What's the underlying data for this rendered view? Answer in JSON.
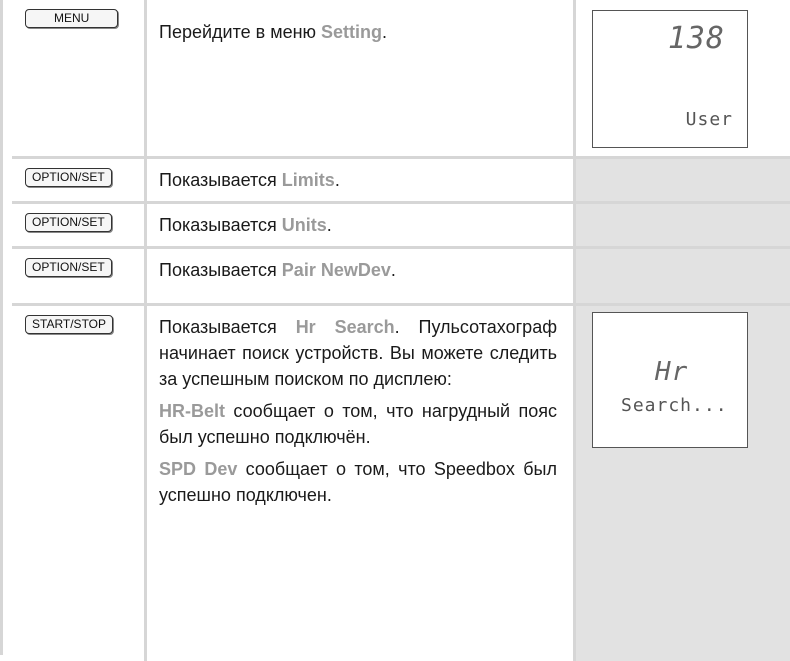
{
  "rows": [
    {
      "button": "MENU",
      "text_pre": "Перейдите в меню ",
      "highlight": "Setting",
      "text_post": ".",
      "display": {
        "top": "138",
        "bottom": "User"
      }
    },
    {
      "button": "OPTION/SET",
      "text_pre": "Показывается ",
      "highlight": "Limits",
      "text_post": "."
    },
    {
      "button": "OPTION/SET",
      "text_pre": "Показывается ",
      "highlight": "Units",
      "text_post": "."
    },
    {
      "button": "OPTION/SET",
      "text_pre": "Показывается ",
      "highlight": "Pair NewDev",
      "text_post": "."
    },
    {
      "button": "START/STOP",
      "text_pre": "Показывается ",
      "highlight": "Hr Search",
      "text_post": ". Пульсотахограф начинает поиск устройств. Вы можете следить за успешным поиском по дисплею:",
      "para2_highlight": "HR-Belt",
      "para2_text": " сообщает о том, что нагрудный пояс был успешно подключён.",
      "para3_highlight": "SPD Dev",
      "para3_text": " сообщает о том, что Speedbox был успешно подключен.",
      "display": {
        "top": "Hr",
        "bottom": "Search..."
      }
    }
  ]
}
